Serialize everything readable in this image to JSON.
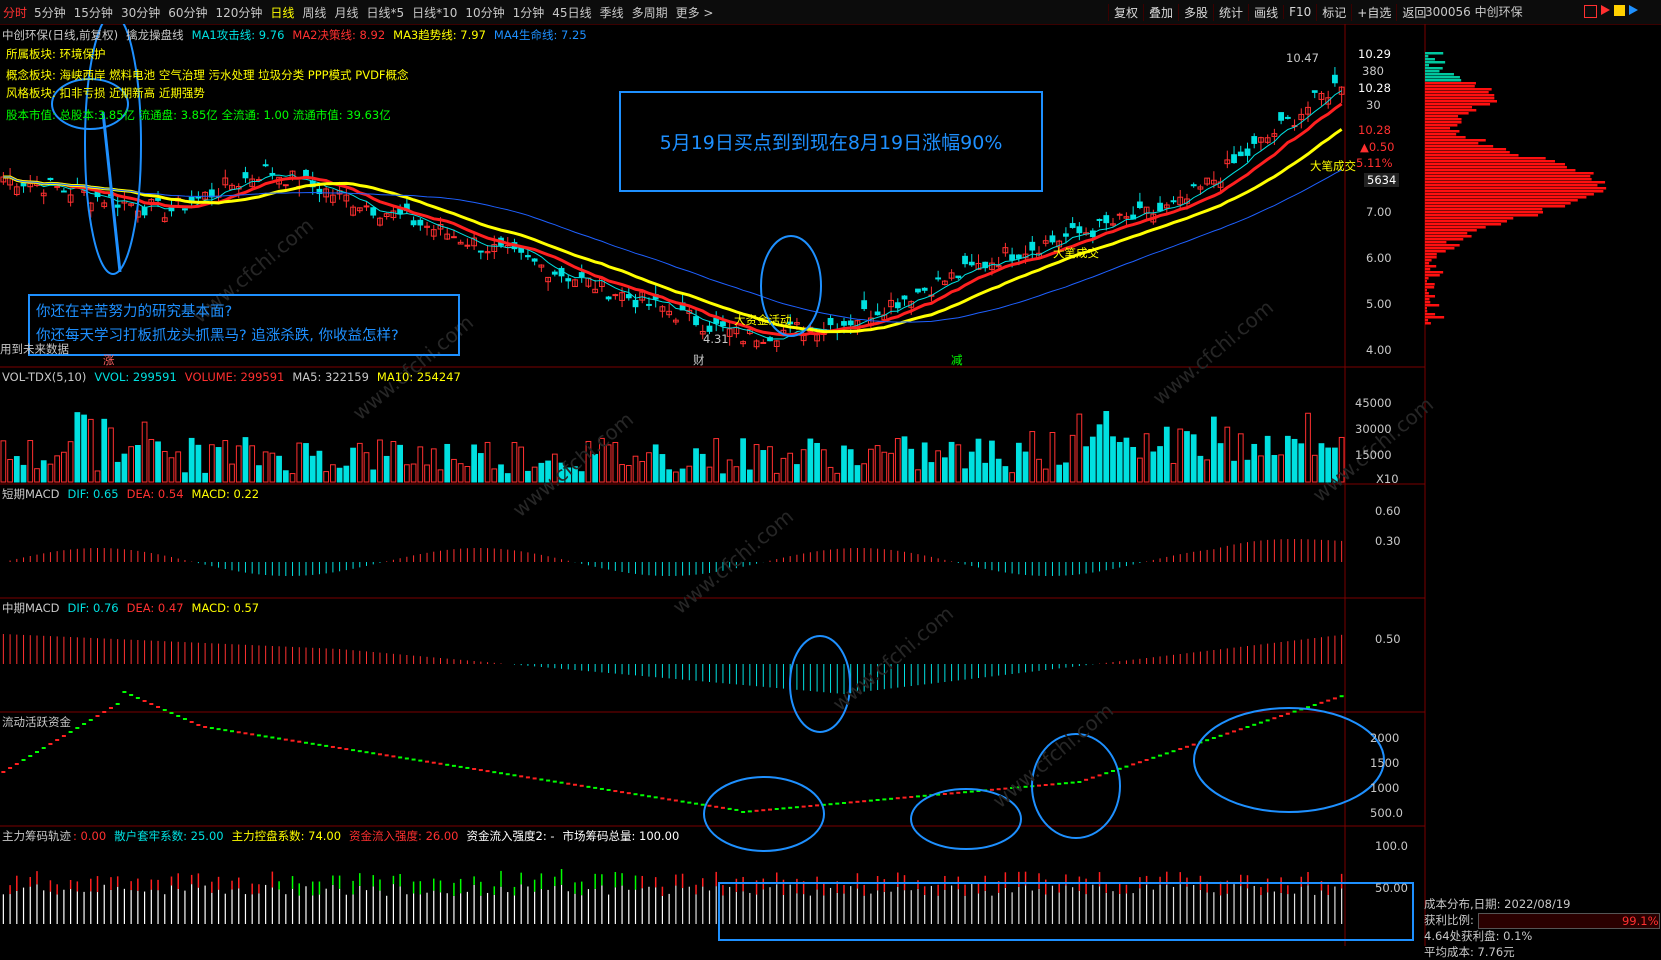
{
  "toolbar": {
    "first": "分时",
    "timeframes": [
      "5分钟",
      "15分钟",
      "30分钟",
      "60分钟",
      "120分钟",
      "日线",
      "周线",
      "月线",
      "日线*5",
      "日线*10",
      "10分钟",
      "1分钟",
      "45日线",
      "季线",
      "多周期",
      "更多 >"
    ],
    "active": "日线",
    "tools": [
      "复权",
      "叠加",
      "多股",
      "统计",
      "画线",
      "F10",
      "标记",
      "+自选",
      "返回"
    ],
    "stock": "300056 中创环保"
  },
  "main_header": {
    "title": "中创环保(日线,前复权)",
    "indicator": "擒龙操盘线",
    "ma1": "MA1攻击线: 9.76",
    "ma2": "MA2决策线: 8.92",
    "ma3": "MA3趋势线: 7.97",
    "ma4": "MA4生命线: 7.25"
  },
  "info": {
    "sector": "所属板块: 环境保护",
    "concept": "概念板块: 海峡西岸 燃料电池 空气治理 污水处理 垃圾分类 PPP模式 PVDF概念",
    "style": "风格板块: 扣非亏损 近期新高 近期强势",
    "equity": "股本市值: 总股本:3.85亿 流通盘: 3.85亿 全流通: 1.00 流通市值: 39.63亿"
  },
  "annotations": {
    "box1": "5月19日买点到到现在8月19日涨幅90%",
    "box2_line1": "你还在辛苦努力的研究基本面?",
    "box2_line2": "你还每天学习打板抓龙头抓黑马? 追涨杀跌, 你收益怎样?"
  },
  "price_labels": {
    "high": "10.47",
    "low": "4.31",
    "big_money": "大资金活动",
    "big_trade1": "大笔成交",
    "big_trade2": "大笔成交",
    "future": "用到未来数据",
    "zhang": "涨",
    "cai": "财",
    "jian": "减"
  },
  "price_axis": [
    "10.29",
    "380",
    "10.28",
    "30",
    "10.28",
    "▲0.50",
    "5.11%",
    "5634",
    "7.00",
    "6.00",
    "5.00",
    "4.00"
  ],
  "vol": {
    "header": "VOL-TDX(5,10)",
    "vvol": "VVOL: 299591",
    "volume": "VOLUME: 299591",
    "ma5": "MA5: 322159",
    "ma10": "MA10: 254247",
    "axis": [
      "45000",
      "30000",
      "15000"
    ],
    "x10": "X10"
  },
  "macd1": {
    "header": "短期MACD",
    "dif": "DIF: 0.65",
    "dea": "DEA: 0.54",
    "macd": "MACD: 0.22",
    "axis": [
      "0.60",
      "0.30"
    ]
  },
  "macd2": {
    "header": "中期MACD",
    "dif": "DIF: 0.76",
    "dea": "DEA: 0.47",
    "macd": "MACD: 0.57",
    "axis": [
      "0.50"
    ]
  },
  "liq": {
    "header": "流动活跃资金",
    "axis": [
      "2000",
      "1500",
      "1000",
      "500.0"
    ]
  },
  "chip": {
    "header": "主力筹码轨迹",
    "v0": ": 0.00",
    "retail": "散户套牢系数: 25.00",
    "control": "主力控盘系数: 74.00",
    "inflow": "资金流入强度: 26.00",
    "inflow2": "资金流入强度2: -",
    "total": "市场筹码总量: 100.00",
    "axis": [
      "100.0",
      "50.00"
    ]
  },
  "cost": {
    "date": "成本分布,日期: 2022/08/19",
    "profit_label": "获利比例:",
    "profit_value": "99.1%",
    "profit_at": "4.64处获利盘: 0.1%",
    "avg": "平均成本: 7.76元"
  },
  "watermark": "www.cfchi.com"
}
